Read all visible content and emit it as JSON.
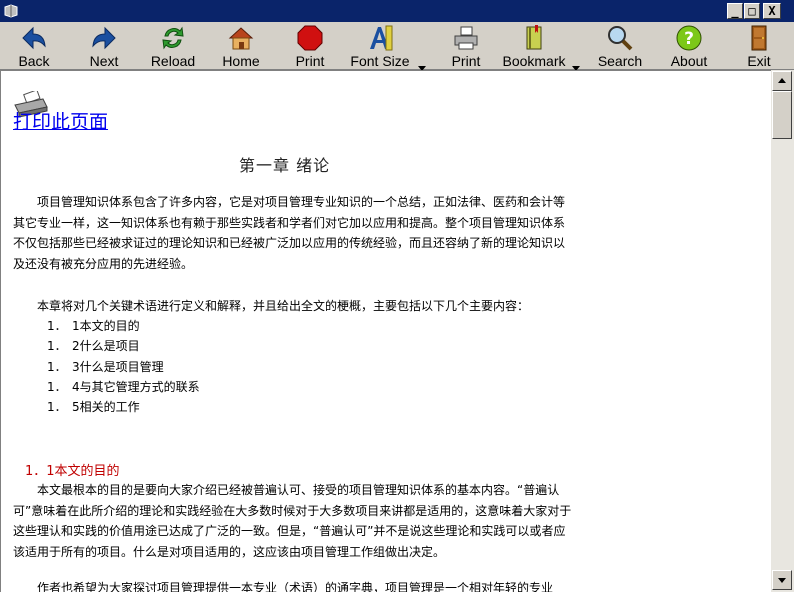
{
  "window": {
    "minimize": "_",
    "maximize": "□",
    "close": "X"
  },
  "toolbar": {
    "back": "Back",
    "forward": "Next",
    "reload": "Reload",
    "home": "Home",
    "print": "Print",
    "font_size": "Font Size",
    "print2": "Print",
    "bookmark": "Bookmark",
    "search": "Search",
    "about": "About",
    "exit": "Exit"
  },
  "content": {
    "print_link": "打印此页面",
    "chapter_title": "第一章  绪论",
    "para1": "项目管理知识体系包含了许多内容，它是对项目管理专业知识的一个总结，正如法律、医药和会计等其它专业一样，这一知识体系也有赖于那些实践者和学者们对它加以应用和提高。整个项目管理知识体系不仅包括那些已经被求证过的理论知识和已经被广泛加以应用的传统经验，而且还容纳了新的理论知识以及还没有被充分应用的先进经验。",
    "para2": "本章将对几个关键术语进行定义和解释，并且给出全文的梗概，主要包括以下几个主要内容：",
    "list": [
      {
        "num": "1．",
        "text": "1本文的目的"
      },
      {
        "num": "1．",
        "text": "2什么是项目"
      },
      {
        "num": "1．",
        "text": "3什么是项目管理"
      },
      {
        "num": "1．",
        "text": "4与其它管理方式的联系"
      },
      {
        "num": "1．",
        "text": "5相关的工作"
      }
    ],
    "section1_title": "1．1本文的目的",
    "para3": "本文最根本的目的是要向大家介绍已经被普遍认可、接受的项目管理知识体系的基本内容。“普遍认可”意味着在此所介绍的理论和实践经验在大多数时候对于大多数项目来讲都是适用的，这意味着大家对于这些理认和实践的价值用途已达成了广泛的一致。但是，“普遍认可”并不是说这些理论和实践可以或者应该适用于所有的项目。什么是对项目适用的，这应该由项目管理工作组做出决定。",
    "para4": "作者也希望为大家探讨项目管理提供一本专业（术语）的通字典，项目管理是一个相对年轻的专业"
  },
  "colors": {
    "titlebar": "#0a246a",
    "link": "#0000ee",
    "section_head": "#c00000"
  },
  "icons": [
    "back-arrow-icon",
    "forward-arrow-icon",
    "reload-icon",
    "home-icon",
    "stop-sign-icon",
    "font-size-icon",
    "printer-icon",
    "bookmark-book-icon",
    "magnifier-icon",
    "help-icon",
    "exit-door-icon"
  ]
}
